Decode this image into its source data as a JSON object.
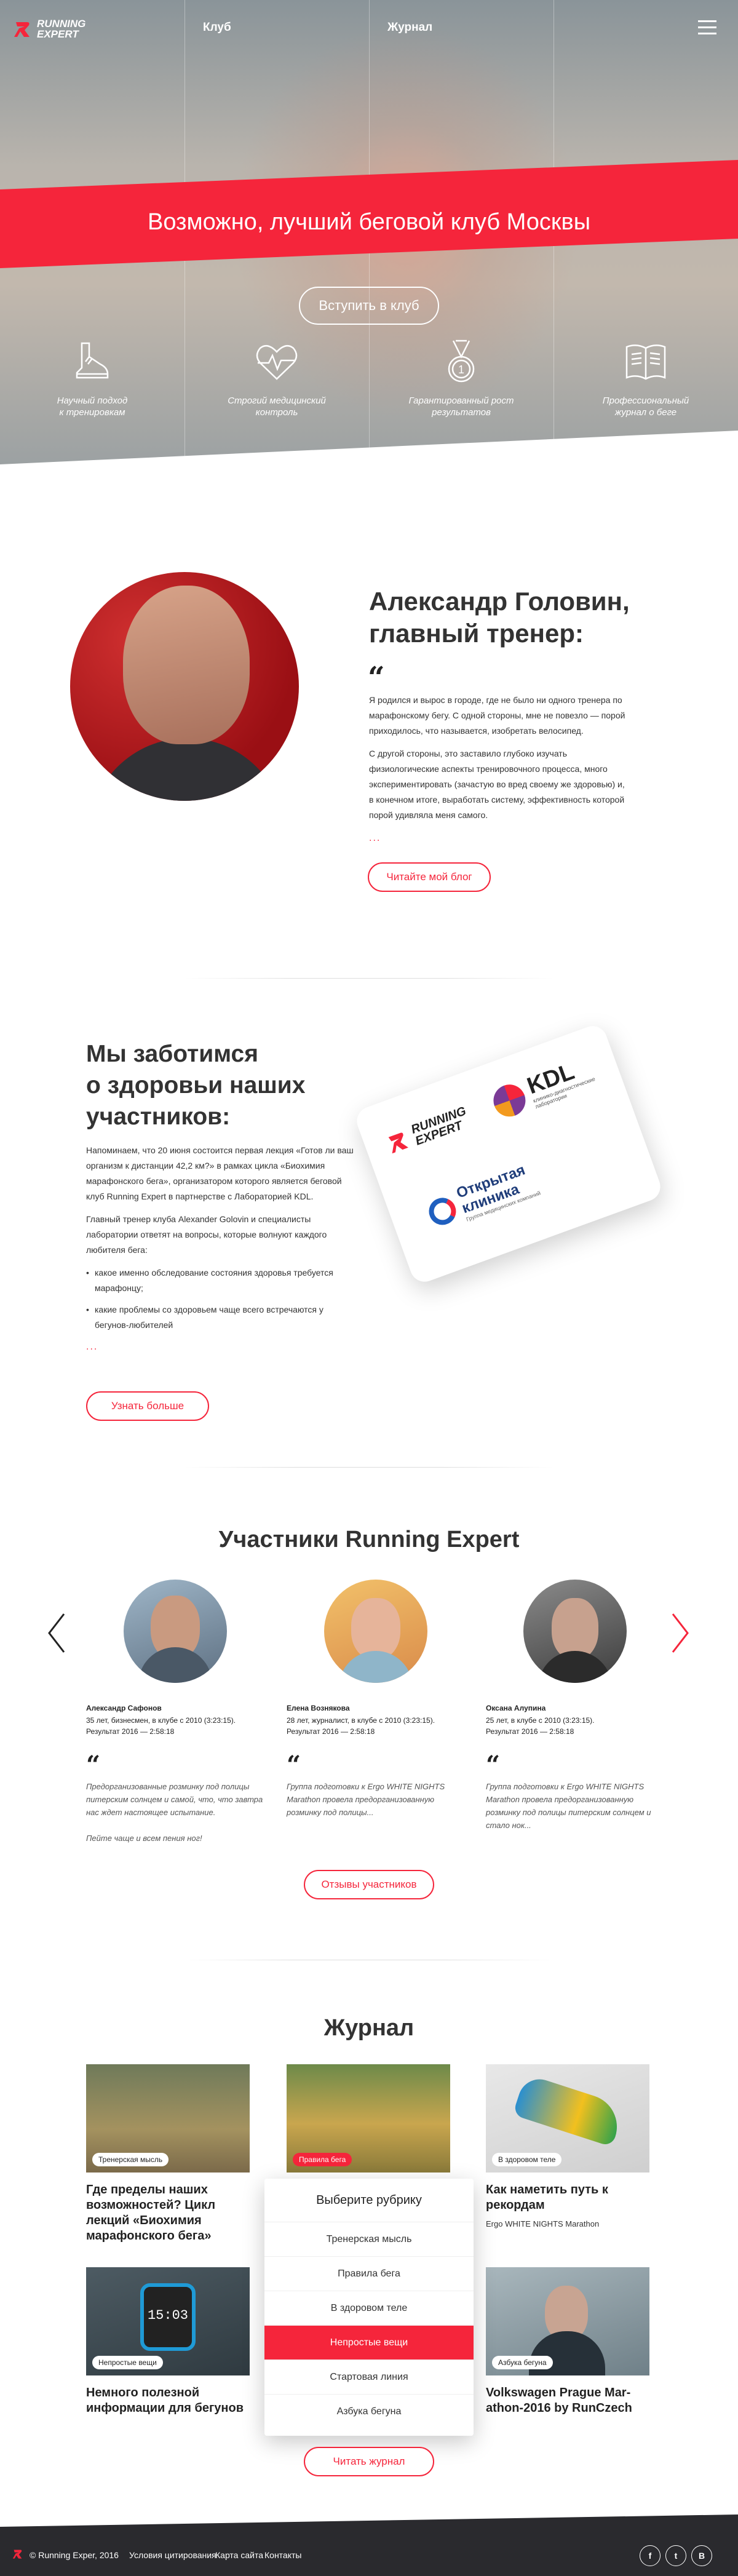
{
  "brand": {
    "logo_line1": "RUNNING",
    "logo_line2": "EXPERT",
    "accent": "#f5253b"
  },
  "nav": {
    "club": "Клуб",
    "journal": "Журнал"
  },
  "hero": {
    "title": "Возможно, лучший беговой клуб Москвы",
    "join": "Вступить в клуб",
    "features": [
      {
        "icon": "running-shoe-icon",
        "caption": "Научный подход\nк тренировкам"
      },
      {
        "icon": "heartbeat-icon",
        "caption": "Строгий медицинский\nконтроль"
      },
      {
        "icon": "medal-icon",
        "caption": "Гарантированный рост\nрезультатов"
      },
      {
        "icon": "magazine-icon",
        "caption": "Профессиональный\nжурнал о беге"
      }
    ]
  },
  "coach": {
    "name": "Александр Головин,\nглавный тренер:",
    "p1": "Я родился и вырос в городе, где не было ни одного тренера по марафонскому бегу. С одной стороны, мне не повезло — порой приходилось, что называется, изобретать велосипед.",
    "p2": "С другой стороны, это заставило глубоко изучать физиологические аспекты тренировочного процесса, много экспериментировать (зачастую во вред своему же здоровью) и, в конечном итоге, выработать систему, эффективность которой порой удивляла меня самого.",
    "ellipsis": "...",
    "blog_btn": "Читайте мой блог"
  },
  "health": {
    "title": "Мы заботимся\nо здоровьи наших\nучастников:",
    "p1": "Напоминаем, что 20 июня состоится первая лекция «Готов ли ваш организм к дистанции 42,2 км?» в рамках цикла «Биохимия марафонского бега», организатором которого является беговой клуб Running Expert в партнерстве с Лабораторией KDL.",
    "p2": "Главный тренер клуба Alexander Golovin и специалисты лаборатории ответят на вопросы, которые волнуют каждого любителя бега:",
    "bullets": [
      "какое именно обследование состояния здоровья требуется марафонцу;",
      "какие проблемы со здоровьем чаще всего встречаются у бегунов-любителей"
    ],
    "ellipsis": "...",
    "more_btn": "Узнать больше",
    "card": {
      "kdl": "KDL",
      "kdl_sub": "клинико-диагностические лаборатории",
      "clinic1": "Открытая",
      "clinic2": "клиника",
      "clinic_sub": "Группа медицинских компаний"
    }
  },
  "members": {
    "title": "Участники Running Expert",
    "items": [
      {
        "name": "Александр Сафонов",
        "info": "35 лет, бизнесмен, в клубе с 2010 (3:23:15).\nРезультат 2016 — 2:58:18",
        "quote": "Предорганизованные розминку под полицы питерским солнцем и самой, что, что завтра нас ждет настоящее испытание.\n\nПейте чаще и всем пения ног!"
      },
      {
        "name": "Елена Вознякова",
        "info": "28 лет, журналист, в клубе с 2010 (3:23:15).\nРезультат 2016 — 2:58:18",
        "quote": "Группа подготовки к Ergo WHITE NIGHTS Marathon провела предорганизованную розминку под полицы..."
      },
      {
        "name": "Оксана Алупина",
        "info": "25 лет, в клубе с 2010 (3:23:15).\nРезультат 2016 — 2:58:18",
        "quote": "Группа подготовки к Ergo WHITE NIGHTS Marathon провела предорганизованную розминку под полицы питерским солнцем и стало нок..."
      }
    ],
    "reviews_btn": "Отзывы участников"
  },
  "journal": {
    "title": "Журнал",
    "cards": [
      {
        "tag": "Тренерская мысль",
        "title": "Где пределы наших возможностей? Цикл лекций «Биохимия марафонского бега»",
        "sub": ""
      },
      {
        "tag": "Правила бега",
        "title": "",
        "sub": ""
      },
      {
        "tag": "В здоровом теле",
        "title": "Как наметить путь к рекордам",
        "sub": "Ergo WHITE NIGHTS Marathon"
      },
      {
        "tag": "Непростые вещи",
        "title": "Немного полезной информации для бегунов",
        "sub": ""
      },
      {
        "tag": "Азбука бегуна",
        "title": "Volkswagen Prague Mar-athon-2016 by RunCzech",
        "sub": ""
      }
    ],
    "watch_time": "15:03",
    "dropdown": {
      "header": "Выберите рубрику",
      "options": [
        "Тренерская мысль",
        "Правила бега",
        "В здоровом теле",
        "Непростые вещи",
        "Стартовая линия",
        "Азбука бегуна"
      ],
      "selected_index": 3
    },
    "read_btn": "Читать журнал"
  },
  "footer": {
    "copyright": "© Running Exper, 2016",
    "terms": "Условия цитирования",
    "sitemap": "Карта сайта",
    "contacts": "Контакты",
    "social": [
      "f",
      "t",
      "В"
    ]
  }
}
